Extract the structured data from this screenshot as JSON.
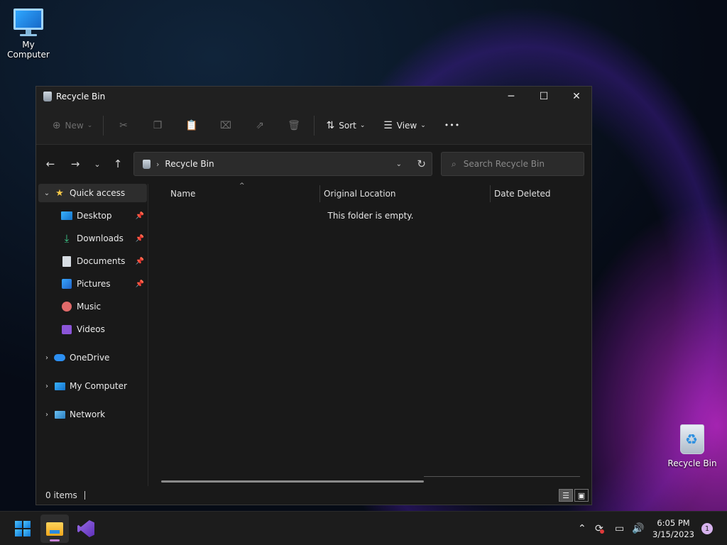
{
  "desktop": {
    "icons": [
      {
        "label": "My Computer"
      },
      {
        "label": "Recycle Bin"
      }
    ]
  },
  "window": {
    "title": "Recycle Bin",
    "controls": {
      "minimize": "─",
      "maximize": "☐",
      "close": "✕"
    }
  },
  "toolbar": {
    "new_label": "New",
    "sort_label": "Sort",
    "view_label": "View",
    "more_label": "•••"
  },
  "address": {
    "crumbs": [
      "Recycle Bin"
    ],
    "search_placeholder": "Search Recycle Bin"
  },
  "navpane": {
    "items": [
      {
        "label": "Quick access",
        "icon": "star-icon",
        "selected": true
      },
      {
        "label": "Desktop",
        "icon": "desktop-folder-icon",
        "pinned": true
      },
      {
        "label": "Downloads",
        "icon": "download-icon",
        "pinned": true
      },
      {
        "label": "Documents",
        "icon": "documents-icon",
        "pinned": true
      },
      {
        "label": "Pictures",
        "icon": "pictures-icon",
        "pinned": true
      },
      {
        "label": "Music",
        "icon": "music-icon"
      },
      {
        "label": "Videos",
        "icon": "videos-icon"
      },
      {
        "label": "OneDrive",
        "icon": "onedrive-icon"
      },
      {
        "label": "My Computer",
        "icon": "computer-icon"
      },
      {
        "label": "Network",
        "icon": "network-icon"
      }
    ]
  },
  "content": {
    "columns": [
      "Name",
      "Original Location",
      "Date Deleted"
    ],
    "empty_message": "This folder is empty."
  },
  "status": {
    "item_count": "0 items"
  },
  "taskbar": {
    "clock_time": "6:05 PM",
    "clock_date": "3/15/2023",
    "notification_count": "1"
  },
  "colors": {
    "window_bg": "#191919",
    "toolbar_bg": "#202020",
    "accent": "#4cc2ff"
  }
}
